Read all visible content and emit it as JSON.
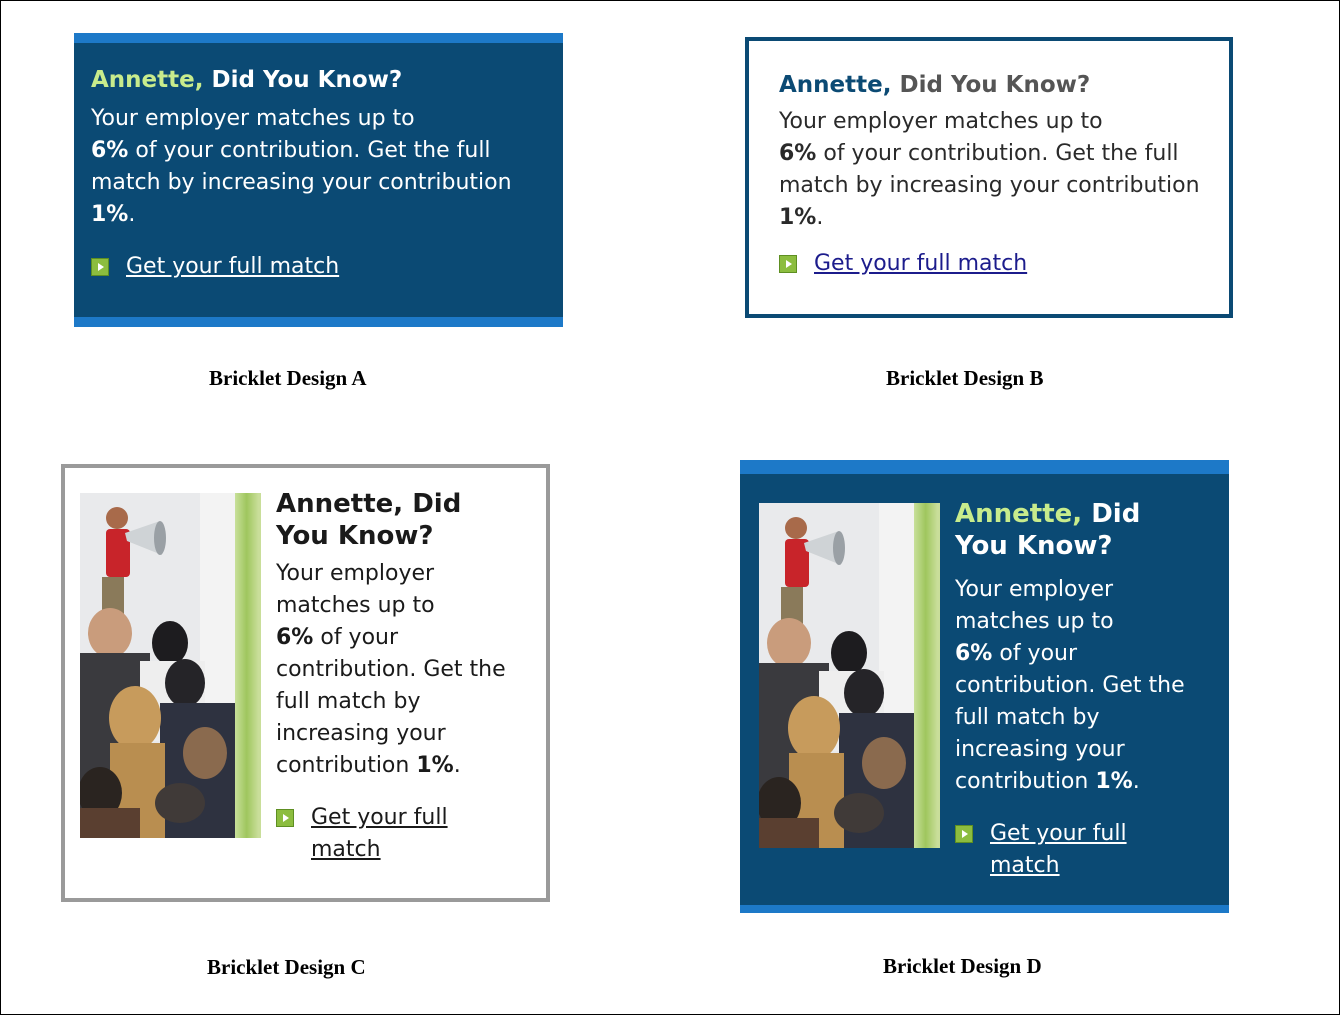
{
  "designs": [
    {
      "caption": "Bricklet Design A",
      "heading_name": "Annette,",
      "heading_rest": " Did You Know?",
      "body_line_1": "Your employer matches up to",
      "body_pct_1": "6%",
      "body_line_2": " of your contribution. Get the full match by increasing your contribution ",
      "body_pct_2": "1%",
      "body_end": ".",
      "link_label": "Get your full match",
      "link_icon": "green-arrow-icon"
    },
    {
      "caption": "Bricklet Design B",
      "heading_name": "Annette,",
      "heading_rest": " Did You Know?",
      "body_line_1": "Your employer matches up to",
      "body_pct_1": "6%",
      "body_line_2": " of your contribution. Get the full match by increasing your contribution ",
      "body_pct_2": "1%",
      "body_end": ".",
      "link_label": "Get your full match",
      "link_icon": "green-arrow-icon"
    },
    {
      "caption": "Bricklet Design C",
      "heading_name": "Annette,",
      "heading_rest": " Did You Know?",
      "body_line_1": "Your employer matches up to",
      "body_pct_1": "6%",
      "body_line_2": " of your contribution. Get the full match by increasing your contribution ",
      "body_pct_2": "1%",
      "body_end": ".",
      "link_label": "Get your full match",
      "link_icon": "green-arrow-icon",
      "photo": "person-with-megaphone-crowd-photo"
    },
    {
      "caption": "Bricklet Design D",
      "heading_name": "Annette,",
      "heading_rest": " Did You Know?",
      "body_line_1": "Your employer matches up to",
      "body_pct_1": "6%",
      "body_line_2": " of your contribution. Get the full match by increasing your contribution ",
      "body_pct_2": "1%",
      "body_end": ".",
      "link_label": "Get your full match",
      "link_icon": "green-arrow-icon",
      "photo": "person-with-megaphone-crowd-photo"
    }
  ],
  "colors": {
    "navy": "#0b4a74",
    "band_blue": "#1d79c8",
    "name_green": "#c8ec8c",
    "arrow_green": "#8cbd3f",
    "frame_gray": "#9a9a9a"
  }
}
